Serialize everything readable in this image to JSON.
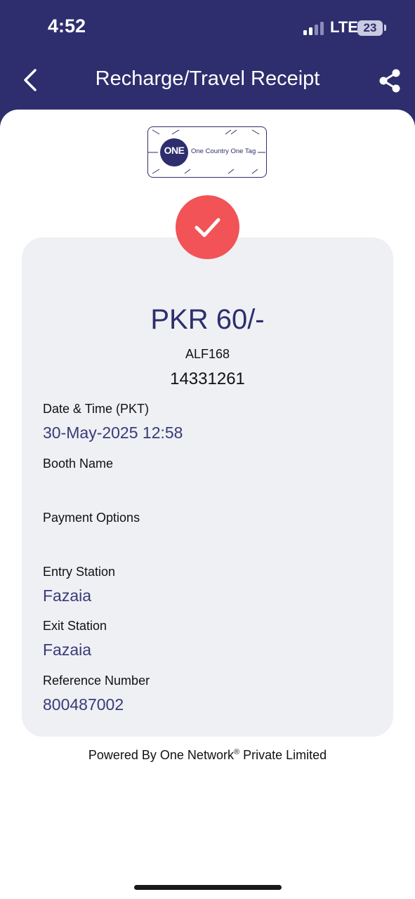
{
  "status_bar": {
    "time": "4:52",
    "network": "LTE",
    "battery": "23"
  },
  "header": {
    "title": "Recharge/Travel Receipt",
    "back_icon": "chevron-left-icon",
    "share_icon": "share-icon",
    "background_color": "#2e2e6e"
  },
  "logo": {
    "mark": "ONE",
    "tagline": "One Country One Tag"
  },
  "status_icon": {
    "icon": "check-icon",
    "color": "#f15356"
  },
  "receipt": {
    "amount": "PKR 60/-",
    "vehicle_number": "ALF168",
    "transaction_id": "14331261",
    "fields": {
      "date_time_label": "Date & Time (PKT)",
      "date_time_value": "30-May-2025 12:58",
      "booth_name_label": "Booth Name",
      "payment_options_label": "Payment Options",
      "entry_station_label": "Entry Station",
      "entry_station_value": "Fazaia",
      "exit_station_label": "Exit Station",
      "exit_station_value": "Fazaia",
      "reference_number_label": "Reference Number",
      "reference_number_value": "800487002"
    }
  },
  "footer": {
    "powered_prefix": "Powered By One Network",
    "registered_mark": "®",
    "powered_suffix": " Private Limited"
  }
}
